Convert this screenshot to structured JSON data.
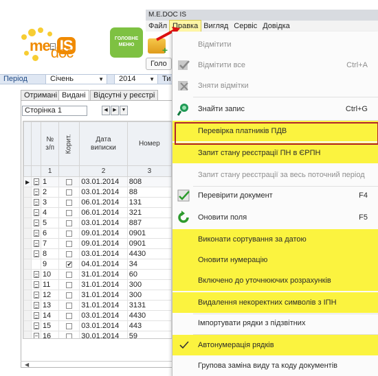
{
  "window": {
    "title": "M.E.DOC IS"
  },
  "menu_bar": [
    "Файл",
    "Правка",
    "Вигляд",
    "Сервіс",
    "Довідка"
  ],
  "active_menu": "Правка",
  "logo": {
    "me": "me",
    "doc": "doc",
    "is": "IS"
  },
  "main_menu_button": {
    "line1": "ГОЛОВНЕ",
    "line2": "МЕНЮ"
  },
  "holov_label": "Голо",
  "period": {
    "label": "Період",
    "month": "Січень",
    "year": "2014",
    "type_label": "Ти"
  },
  "tabs": [
    "Отримані",
    "Видані",
    "Відсутні у реєстрі"
  ],
  "active_tab": "Видані",
  "pager": {
    "label": "Сторінка 1"
  },
  "table": {
    "headers": [
      "№ з/п",
      "Коригув.",
      "Дата виписки",
      "Номер"
    ],
    "header_corr_visible": "Корит.",
    "col_numbers": [
      "1",
      "",
      "2",
      "3"
    ],
    "rows": [
      {
        "n": "1",
        "corr": false,
        "date": "03.01.2014",
        "num": "808"
      },
      {
        "n": "2",
        "corr": false,
        "date": "03.01.2014",
        "num": "88"
      },
      {
        "n": "3",
        "corr": false,
        "date": "06.01.2014",
        "num": "131"
      },
      {
        "n": "4",
        "corr": false,
        "date": "06.01.2014",
        "num": "321"
      },
      {
        "n": "5",
        "corr": false,
        "date": "03.01.2014",
        "num": "887"
      },
      {
        "n": "6",
        "corr": false,
        "date": "09.01.2014",
        "num": "0901"
      },
      {
        "n": "7",
        "corr": false,
        "date": "09.01.2014",
        "num": "0901"
      },
      {
        "n": "8",
        "corr": false,
        "date": "03.01.2014",
        "num": "4430"
      },
      {
        "n": "9",
        "corr": true,
        "date": "04.01.2014",
        "num": "34"
      },
      {
        "n": "10",
        "corr": false,
        "date": "31.01.2014",
        "num": "60"
      },
      {
        "n": "11",
        "corr": false,
        "date": "31.01.2014",
        "num": "300"
      },
      {
        "n": "12",
        "corr": false,
        "date": "31.01.2014",
        "num": "300"
      },
      {
        "n": "13",
        "corr": false,
        "date": "31.01.2014",
        "num": "3131"
      },
      {
        "n": "14",
        "corr": false,
        "date": "03.01.2014",
        "num": "4430"
      },
      {
        "n": "15",
        "corr": false,
        "date": "03.01.2014",
        "num": "443"
      },
      {
        "n": "16",
        "corr": false,
        "date": "30.01.2014",
        "num": "59"
      }
    ]
  },
  "dropdown": {
    "items": [
      {
        "label": "Відмітити",
        "shortcut": "",
        "disabled": true,
        "highlight": false,
        "icon": ""
      },
      {
        "label": "Відмітити все",
        "shortcut": "Ctrl+A",
        "disabled": true,
        "highlight": false,
        "icon": "check-all-icon"
      },
      {
        "label": "Зняти відмітки",
        "shortcut": "",
        "disabled": true,
        "highlight": false,
        "icon": "uncheck-icon"
      },
      {
        "label": "Знайти запис",
        "shortcut": "Ctrl+G",
        "disabled": false,
        "highlight": false,
        "icon": "search-icon"
      },
      {
        "label": "Перевірка платників ПДВ",
        "shortcut": "",
        "disabled": false,
        "highlight": true,
        "icon": ""
      },
      {
        "label": "Запит стану реєстрації ПН в ЄРПН",
        "shortcut": "",
        "disabled": false,
        "highlight": true,
        "icon": ""
      },
      {
        "label": "Запит стану реєстрації за весь поточний період",
        "shortcut": "",
        "disabled": true,
        "highlight": false,
        "icon": ""
      },
      {
        "label": "Перевірити документ",
        "shortcut": "F4",
        "disabled": false,
        "highlight": false,
        "icon": "check-document-icon"
      },
      {
        "label": "Оновити поля",
        "shortcut": "F5",
        "disabled": false,
        "highlight": false,
        "icon": "refresh-icon"
      },
      {
        "label": "Виконати сортування за датою",
        "shortcut": "",
        "disabled": false,
        "highlight": true,
        "icon": ""
      },
      {
        "label": "Оновити нумерацію",
        "shortcut": "",
        "disabled": false,
        "highlight": true,
        "icon": ""
      },
      {
        "label": "Включено до уточнюючих розрахунків",
        "shortcut": "",
        "disabled": false,
        "highlight": true,
        "icon": ""
      },
      {
        "label": "Видалення некоректних символів з ІПН",
        "shortcut": "",
        "disabled": false,
        "highlight": true,
        "icon": ""
      },
      {
        "label": "Імпортувати рядки з підзвітних",
        "shortcut": "",
        "disabled": false,
        "highlight": false,
        "icon": ""
      },
      {
        "label": "Автонумерація рядків",
        "shortcut": "",
        "disabled": false,
        "highlight": true,
        "icon": "checkmark-icon"
      },
      {
        "label": "Групова заміна виду та коду документів",
        "shortcut": "",
        "disabled": false,
        "highlight": false,
        "icon": ""
      }
    ]
  },
  "colors": {
    "highlight": "#fbf33f",
    "frame": "#b1232a",
    "logo_orange": "#f08a00",
    "menu_green": "#7ec142"
  }
}
